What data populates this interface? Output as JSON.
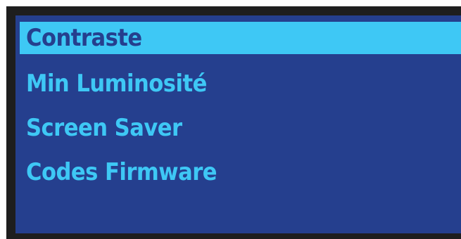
{
  "menu": {
    "items": [
      {
        "label": "Contraste",
        "selected": true
      },
      {
        "label": "Min Luminosité",
        "selected": false
      },
      {
        "label": "Screen Saver",
        "selected": false
      },
      {
        "label": "Codes Firmware",
        "selected": false
      }
    ]
  },
  "colors": {
    "background": "#253f8e",
    "text": "#3ec8f5",
    "highlight": "#3ec8f5",
    "bezel": "#1e1e1e"
  }
}
